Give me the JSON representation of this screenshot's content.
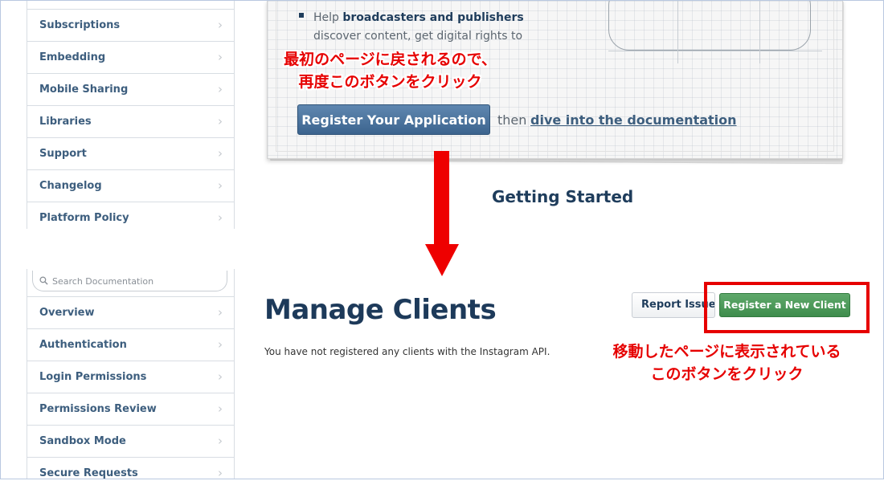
{
  "top_sidebar": {
    "items": [
      {
        "label": "Subscriptions"
      },
      {
        "label": "Embedding"
      },
      {
        "label": "Mobile Sharing"
      },
      {
        "label": "Libraries"
      },
      {
        "label": "Support"
      },
      {
        "label": "Changelog"
      },
      {
        "label": "Platform Policy"
      }
    ]
  },
  "bottom_sidebar": {
    "search": {
      "placeholder": "Search Documentation"
    },
    "items": [
      {
        "label": "Overview"
      },
      {
        "label": "Authentication"
      },
      {
        "label": "Login Permissions"
      },
      {
        "label": "Permissions Review"
      },
      {
        "label": "Sandbox Mode"
      },
      {
        "label": "Secure Requests"
      }
    ]
  },
  "card": {
    "bullet_prefix": "Help ",
    "bullet_bold": "broadcasters and publishers",
    "bullet_line2": "discover content, get digital rights to",
    "register_button": "Register Your Application",
    "then_text": "then",
    "docs_link": "dive into the documentation"
  },
  "annotations": {
    "top_line1": "最初のページに戻されるので、",
    "top_line2": "再度このボタンをクリック",
    "right_line1": "移動したページに表示されている",
    "right_line2": "このボタンをクリック",
    "arrow_color": "#ee0000",
    "highlight_color": "#e60000"
  },
  "getting_started": "Getting Started",
  "manage": {
    "title": "Manage Clients",
    "report_button": "Report Issue",
    "register_button": "Register a New Client",
    "empty_message": "You have not registered any clients with the Instagram API."
  },
  "icons": {
    "chevron": "chevron-right-icon",
    "search": "search-icon",
    "bullet": "square-bullet-icon"
  },
  "colors": {
    "nav_text": "#3d5e7e",
    "title": "#1d3a5a",
    "primary_button": "#4a72a0",
    "success_button": "#4a9a58"
  }
}
